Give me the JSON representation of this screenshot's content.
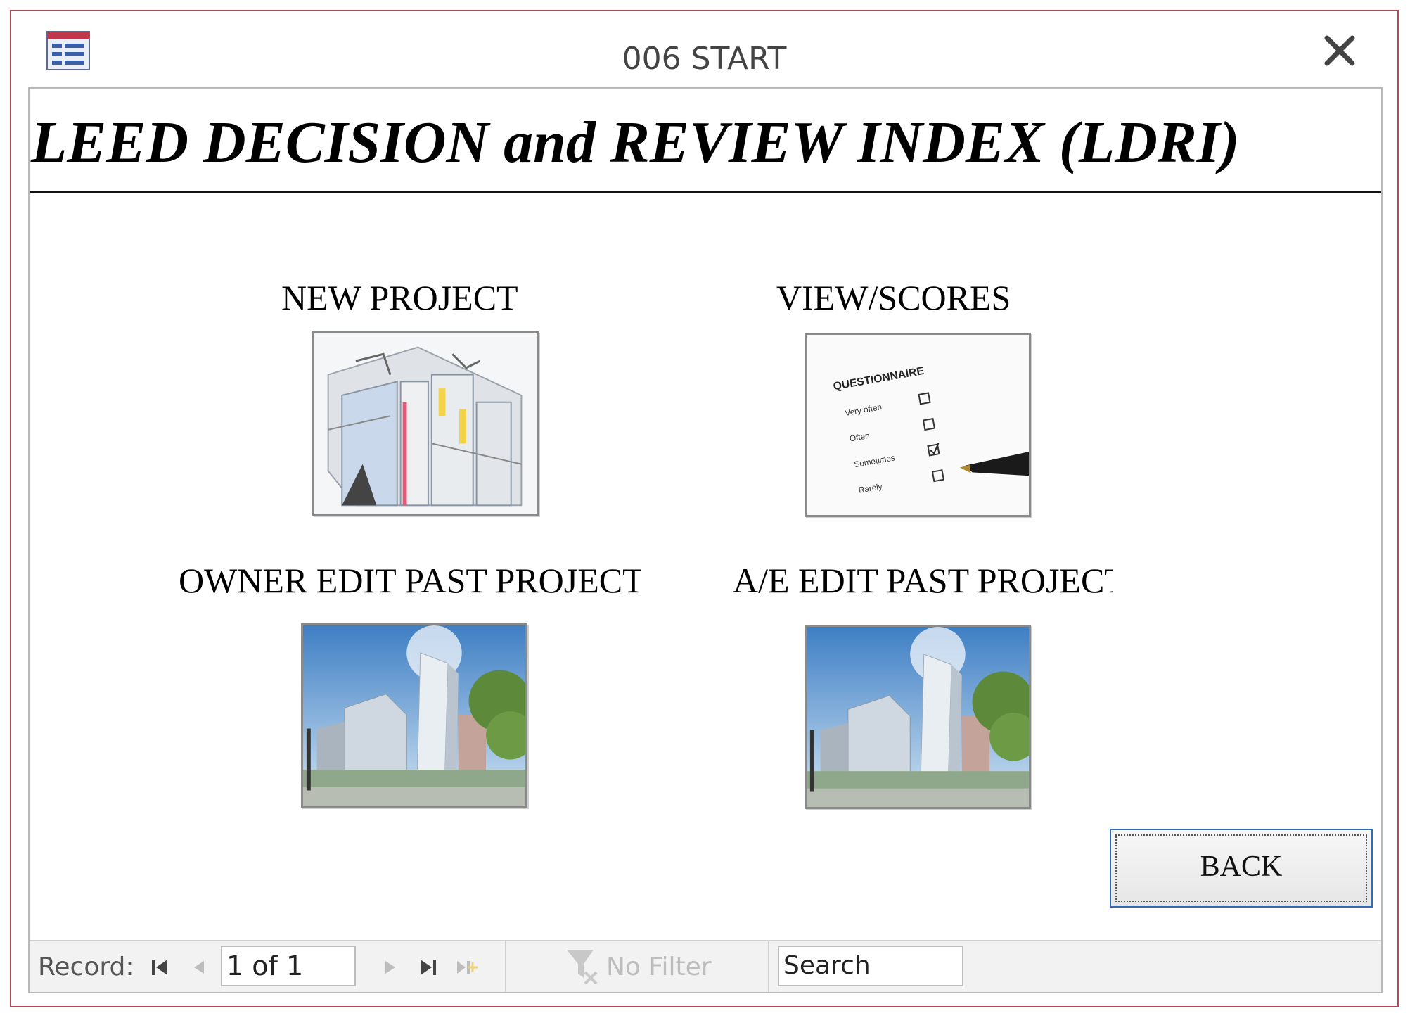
{
  "window": {
    "title": "006 START"
  },
  "form": {
    "title": "LEED DECISION and REVIEW INDEX (LDRI)"
  },
  "buttons": {
    "new_project": "NEW PROJECT",
    "view_scores": "VIEW/SCORES",
    "owner_edit": "OWNER EDIT PAST PROJECT",
    "ae_edit": "A/E EDIT PAST PROJECT",
    "back": "BACK"
  },
  "questionnaire": {
    "heading": "QUESTIONNAIRE",
    "options": [
      "Very often",
      "Often",
      "Sometimes",
      "Rarely"
    ]
  },
  "navigation": {
    "record_label": "Record:",
    "record_value": "1 of 1",
    "filter_label": "No Filter",
    "search_placeholder": "Search"
  },
  "icons": {
    "app": "form-icon",
    "close": "close-icon",
    "first": "first-record-icon",
    "prev": "previous-record-icon",
    "next": "next-record-icon",
    "last": "last-record-icon",
    "new": "new-record-icon",
    "filter": "no-filter-icon"
  },
  "colors": {
    "window_border": "#b04a5a",
    "focus_border": "#2e6db5"
  }
}
